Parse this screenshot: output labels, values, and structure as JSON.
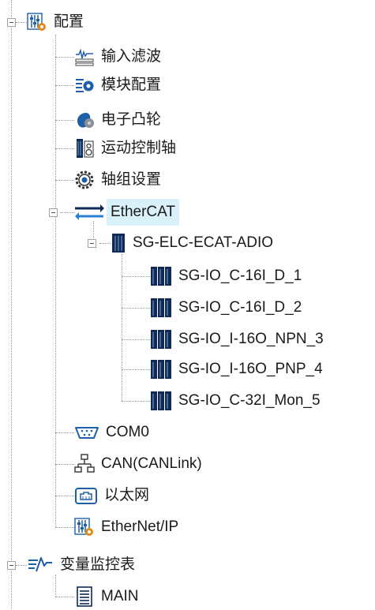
{
  "tree": {
    "config": "配置",
    "input_filter": "输入滤波",
    "module_config": "模块配置",
    "e_cam": "电子凸轮",
    "motion_axis": "运动控制轴",
    "axis_group": "轴组设置",
    "ethercat": "EtherCAT",
    "coupler": "SG-ELC-ECAT-ADIO",
    "io1": "SG-IO_C-16I_D_1",
    "io2": "SG-IO_C-16I_D_2",
    "io3": "SG-IO_I-16O_NPN_3",
    "io4": "SG-IO_I-16O_PNP_4",
    "io5": "SG-IO_C-32I_Mon_5",
    "com0": "COM0",
    "can": "CAN(CANLink)",
    "ethernet": "以太网",
    "ethernet_ip": "EtherNet/IP",
    "var_monitor": "变量监控表",
    "main": "MAIN"
  },
  "colors": {
    "selection": "#d9f1fb",
    "icon_blue": "#1f5fa8",
    "icon_dark": "#0e2a55",
    "gear_orange": "#e08a1e"
  }
}
